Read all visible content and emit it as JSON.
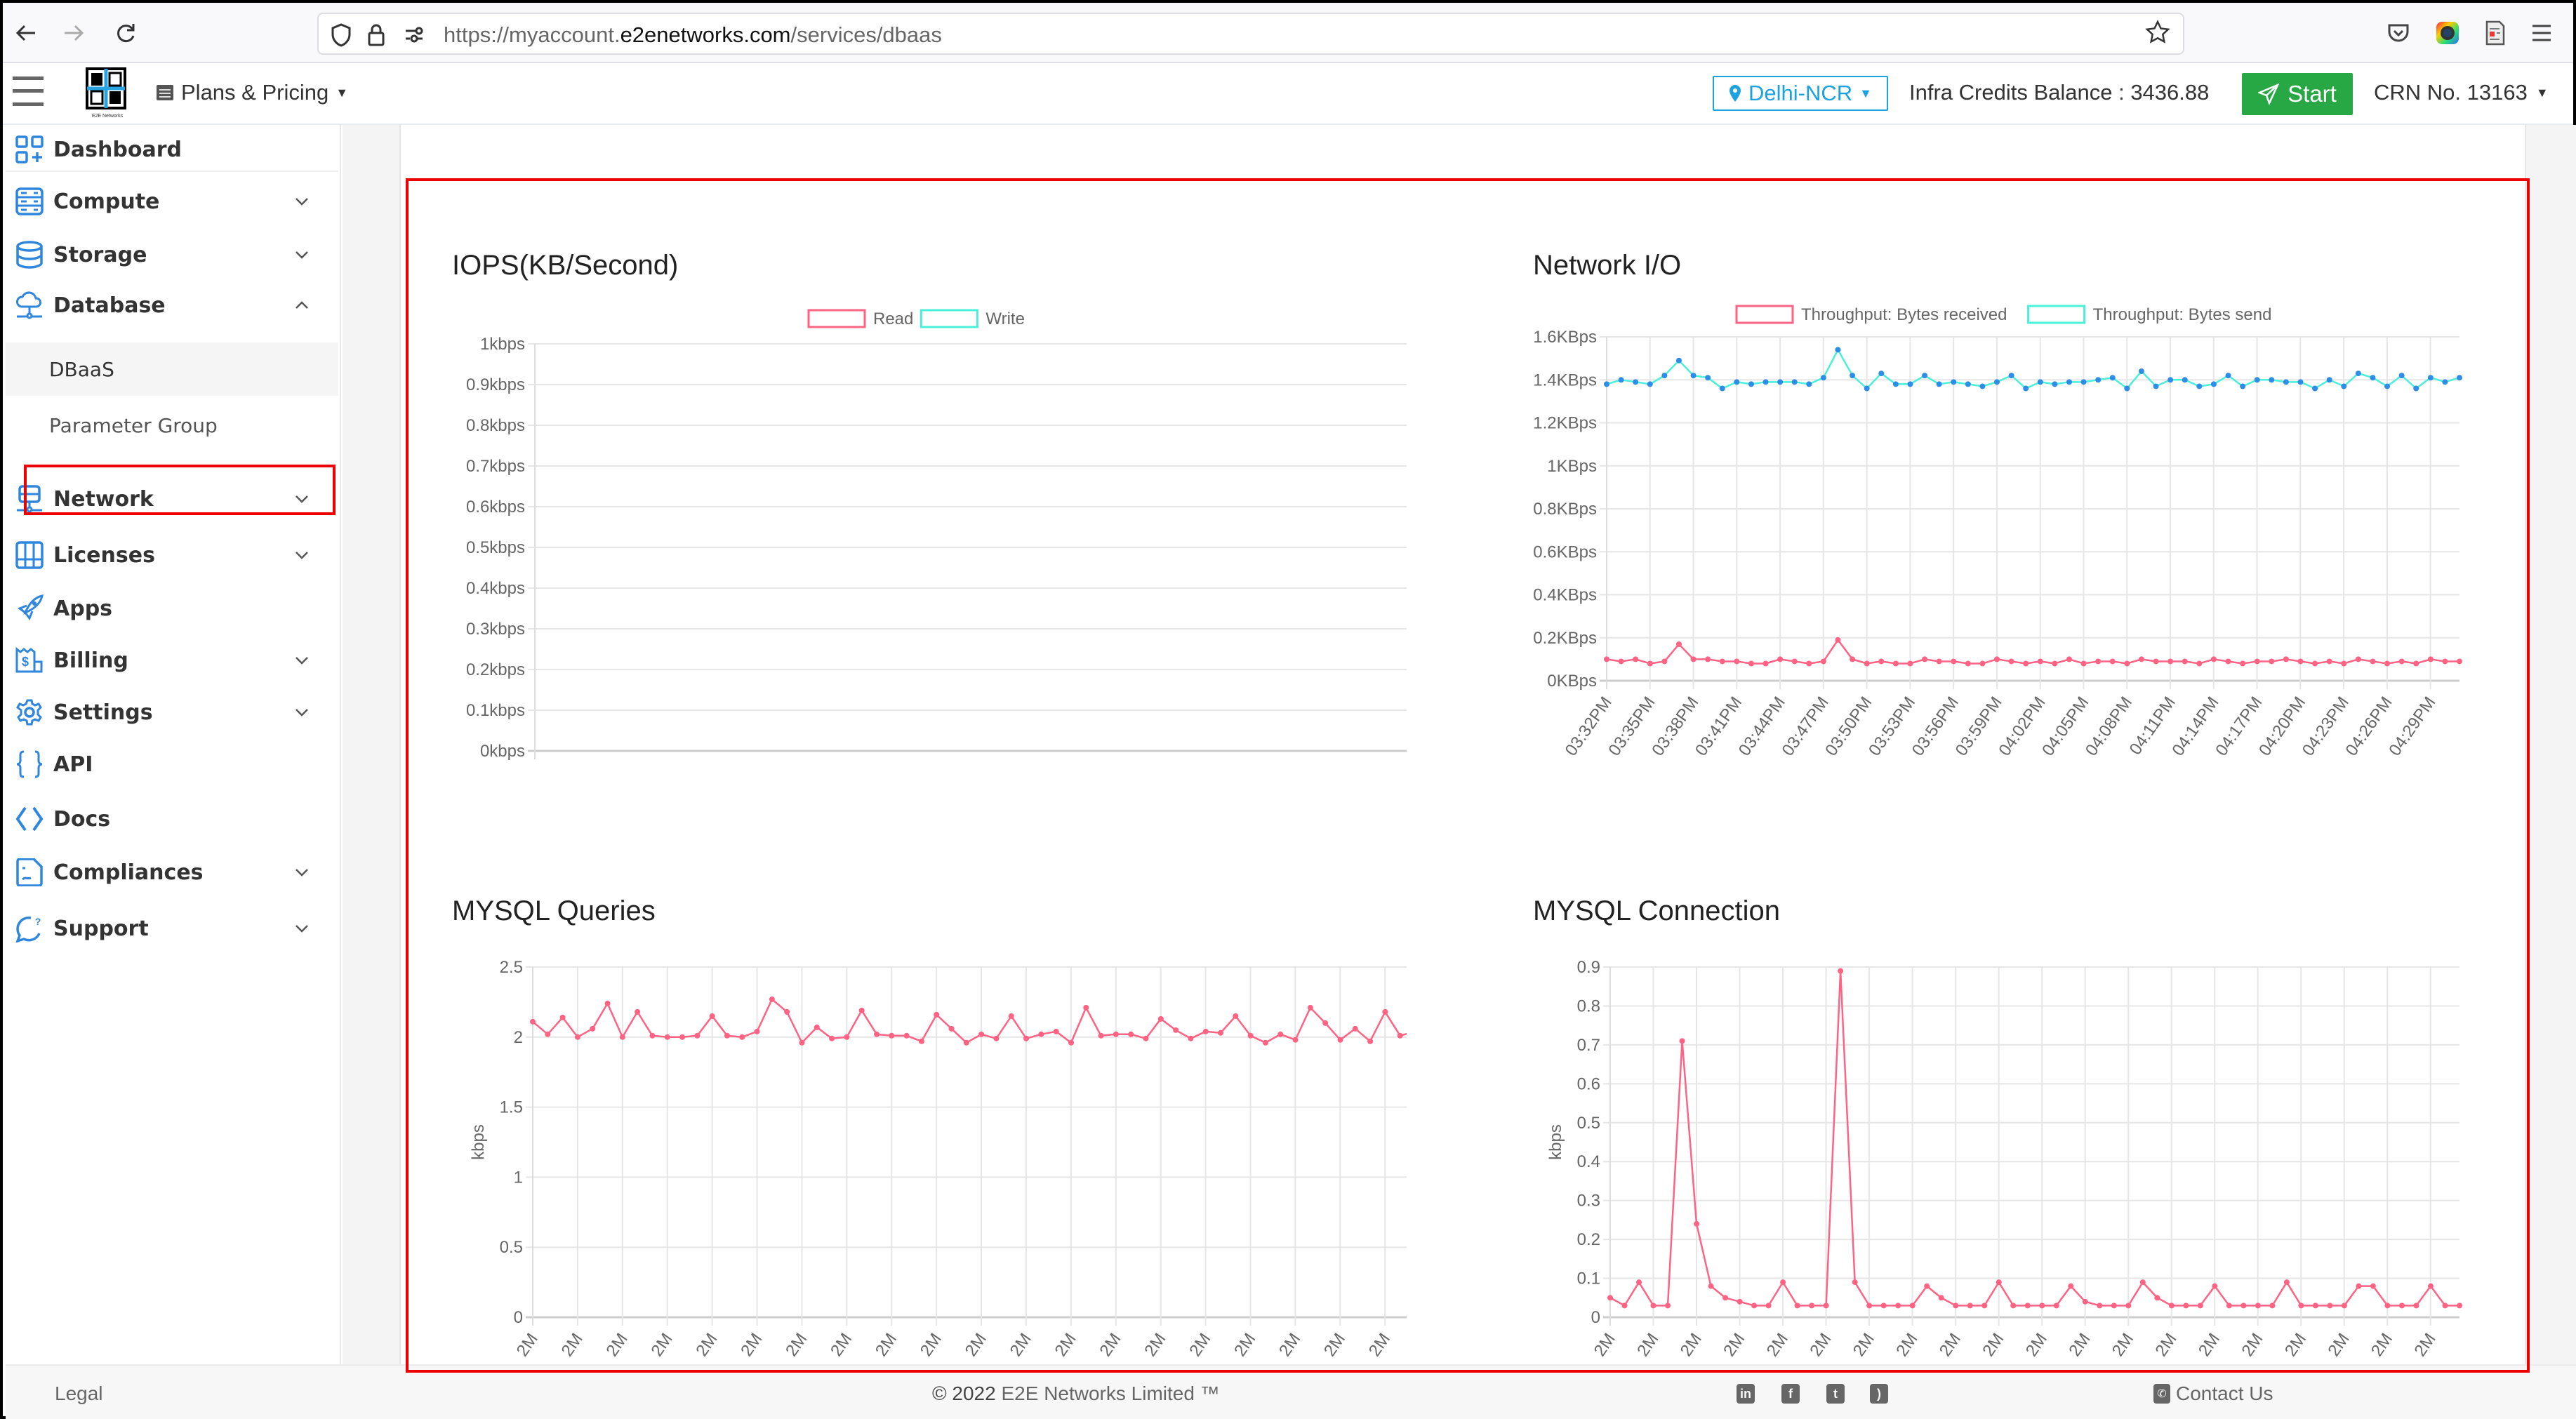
{
  "browser": {
    "url_prefix": "https://myaccount.",
    "url_domain": "e2enetworks.com",
    "url_path": "/services/dbaas"
  },
  "header": {
    "plans_label": "Plans & Pricing",
    "region_label": "Delhi-NCR",
    "credits_text": "Infra Credits Balance : 3436.88",
    "start_label": "Start",
    "crn_text": "CRN No. 13163",
    "logo_caption": "E2E Networks"
  },
  "sidebar": {
    "items": [
      {
        "label": "Dashboard",
        "icon": "dashboard-icon",
        "has_chevron": false
      },
      {
        "label": "Compute",
        "icon": "server-icon",
        "has_chevron": true
      },
      {
        "label": "Storage",
        "icon": "database-icon",
        "has_chevron": true
      },
      {
        "label": "Database",
        "icon": "cloud-network-icon",
        "has_chevron": true,
        "expanded": true
      },
      {
        "label": "Network",
        "icon": "network-icon",
        "has_chevron": true
      },
      {
        "label": "Licenses",
        "icon": "license-icon",
        "has_chevron": true
      },
      {
        "label": "Apps",
        "icon": "rocket-icon",
        "has_chevron": false
      },
      {
        "label": "Billing",
        "icon": "billing-icon",
        "has_chevron": true
      },
      {
        "label": "Settings",
        "icon": "gear-icon",
        "has_chevron": true
      },
      {
        "label": "API",
        "icon": "braces-icon",
        "has_chevron": false
      },
      {
        "label": "Docs",
        "icon": "code-icon",
        "has_chevron": false
      },
      {
        "label": "Compliances",
        "icon": "document-icon",
        "has_chevron": true
      },
      {
        "label": "Support",
        "icon": "support-chat-icon",
        "has_chevron": true
      }
    ],
    "database_sub": [
      {
        "label": "DBaaS",
        "active": true
      },
      {
        "label": "Parameter Group",
        "active": false
      }
    ]
  },
  "footer": {
    "legal": "Legal",
    "copyright_prefix": "© 2022 ",
    "copyright_brand": "E2E Networks Limited ™",
    "contact": "Contact Us",
    "social": [
      "linkedin-icon",
      "facebook-icon",
      "twitter-icon",
      "rss-icon"
    ]
  },
  "chart_data": [
    {
      "id": "iops",
      "type": "line",
      "title": "IOPS(KB/Second)",
      "xlabel": "",
      "ylabel": "",
      "ylim": [
        0,
        1
      ],
      "yticks": [
        "0kbps",
        "0.1kbps",
        "0.2kbps",
        "0.3kbps",
        "0.4kbps",
        "0.5kbps",
        "0.6kbps",
        "0.7kbps",
        "0.8kbps",
        "0.9kbps",
        "1kbps"
      ],
      "legend": "top-center",
      "grid": true,
      "series": [
        {
          "name": "Read",
          "color": "#ff6384",
          "values": []
        },
        {
          "name": "Write",
          "color": "#4bf0d8",
          "values": []
        }
      ]
    },
    {
      "id": "network",
      "type": "line",
      "title": "Network I/O",
      "xlabel": "",
      "ylabel": "",
      "ylim": [
        0,
        1.6
      ],
      "yticks": [
        "0KBps",
        "0.2KBps",
        "0.4KBps",
        "0.6KBps",
        "0.8KBps",
        "1KBps",
        "1.2KBps",
        "1.4KBps",
        "1.6KBps"
      ],
      "xticks": [
        "03:32PM",
        "03:35PM",
        "03:38PM",
        "03:41PM",
        "03:44PM",
        "03:47PM",
        "03:50PM",
        "03:53PM",
        "03:56PM",
        "03:59PM",
        "04:02PM",
        "04:05PM",
        "04:08PM",
        "04:11PM",
        "04:14PM",
        "04:17PM",
        "04:20PM",
        "04:23PM",
        "04:26PM",
        "04:29PM"
      ],
      "legend": "top-center",
      "grid": true,
      "series": [
        {
          "name": "Throughput: Bytes received",
          "color": "#ff6384",
          "point_color": "#ff6384",
          "values": [
            0.1,
            0.09,
            0.1,
            0.08,
            0.09,
            0.17,
            0.1,
            0.1,
            0.09,
            0.09,
            0.08,
            0.08,
            0.1,
            0.09,
            0.08,
            0.09,
            0.19,
            0.1,
            0.08,
            0.09,
            0.08,
            0.08,
            0.1,
            0.09,
            0.09,
            0.08,
            0.08,
            0.1,
            0.09,
            0.08,
            0.09,
            0.08,
            0.1,
            0.08,
            0.09,
            0.09,
            0.08,
            0.1,
            0.09,
            0.09,
            0.09,
            0.08,
            0.1,
            0.09,
            0.08,
            0.09,
            0.09,
            0.1,
            0.09,
            0.08,
            0.09,
            0.08,
            0.1,
            0.09,
            0.08,
            0.09,
            0.08,
            0.1,
            0.09,
            0.09
          ]
        },
        {
          "name": "Throughput: Bytes send",
          "color": "#4bf0d8",
          "point_color": "#2e8de6",
          "values": [
            1.38,
            1.4,
            1.39,
            1.38,
            1.42,
            1.49,
            1.42,
            1.41,
            1.36,
            1.39,
            1.38,
            1.39,
            1.39,
            1.39,
            1.38,
            1.41,
            1.54,
            1.42,
            1.36,
            1.43,
            1.38,
            1.38,
            1.42,
            1.38,
            1.39,
            1.38,
            1.37,
            1.39,
            1.42,
            1.36,
            1.39,
            1.38,
            1.39,
            1.39,
            1.4,
            1.41,
            1.36,
            1.44,
            1.37,
            1.4,
            1.4,
            1.37,
            1.38,
            1.42,
            1.37,
            1.4,
            1.4,
            1.39,
            1.39,
            1.36,
            1.4,
            1.37,
            1.43,
            1.41,
            1.37,
            1.42,
            1.36,
            1.41,
            1.39,
            1.41
          ]
        }
      ]
    },
    {
      "id": "queries",
      "type": "line",
      "title": "MYSQL Queries",
      "xlabel": "",
      "ylabel": "kbps",
      "ylim": [
        0,
        2.5
      ],
      "yticks": [
        "0",
        "0.5",
        "1",
        "1.5",
        "2",
        "2.5"
      ],
      "xticks": [
        "2M",
        "2M",
        "2M",
        "2M",
        "2M",
        "2M",
        "2M",
        "2M",
        "2M",
        "2M",
        "2M",
        "2M",
        "2M",
        "2M",
        "2M",
        "2M",
        "2M",
        "2M",
        "2M",
        "2M"
      ],
      "legend": "none",
      "grid": true,
      "series": [
        {
          "name": "Queries",
          "color": "#ff6384",
          "point_color": "#ff6384",
          "values": [
            2.11,
            2.02,
            2.14,
            2.0,
            2.06,
            2.24,
            2.0,
            2.18,
            2.01,
            2.0,
            2.0,
            2.01,
            2.15,
            2.01,
            2.0,
            2.04,
            2.27,
            2.18,
            1.96,
            2.07,
            1.99,
            2.0,
            2.19,
            2.02,
            2.01,
            2.01,
            1.97,
            2.16,
            2.06,
            1.96,
            2.02,
            1.99,
            2.15,
            1.99,
            2.02,
            2.04,
            1.96,
            2.21,
            2.01,
            2.02,
            2.02,
            1.99,
            2.13,
            2.05,
            1.99,
            2.04,
            2.03,
            2.15,
            2.01,
            1.96,
            2.02,
            1.98,
            2.21,
            2.1,
            1.98,
            2.06,
            1.97,
            2.18,
            2.01,
            2.04
          ]
        }
      ]
    },
    {
      "id": "connections",
      "type": "line",
      "title": "MYSQL Connection",
      "xlabel": "",
      "ylabel": "kbps",
      "ylim": [
        0,
        0.9
      ],
      "yticks": [
        "0",
        "0.1",
        "0.2",
        "0.3",
        "0.4",
        "0.5",
        "0.6",
        "0.7",
        "0.8",
        "0.9"
      ],
      "xticks": [
        "2M",
        "2M",
        "2M",
        "2M",
        "2M",
        "2M",
        "2M",
        "2M",
        "2M",
        "2M",
        "2M",
        "2M",
        "2M",
        "2M",
        "2M",
        "2M",
        "2M",
        "2M",
        "2M",
        "2M"
      ],
      "legend": "none",
      "grid": true,
      "series": [
        {
          "name": "Connections",
          "color": "#ff6384",
          "point_color": "#ff6384",
          "values": [
            0.05,
            0.03,
            0.09,
            0.03,
            0.03,
            0.71,
            0.24,
            0.08,
            0.05,
            0.04,
            0.03,
            0.03,
            0.09,
            0.03,
            0.03,
            0.03,
            0.89,
            0.09,
            0.03,
            0.03,
            0.03,
            0.03,
            0.08,
            0.05,
            0.03,
            0.03,
            0.03,
            0.09,
            0.03,
            0.03,
            0.03,
            0.03,
            0.08,
            0.04,
            0.03,
            0.03,
            0.03,
            0.09,
            0.05,
            0.03,
            0.03,
            0.03,
            0.08,
            0.03,
            0.03,
            0.03,
            0.03,
            0.09,
            0.03,
            0.03,
            0.03,
            0.03,
            0.08,
            0.08,
            0.03,
            0.03,
            0.03,
            0.08,
            0.03,
            0.03
          ]
        }
      ]
    }
  ]
}
